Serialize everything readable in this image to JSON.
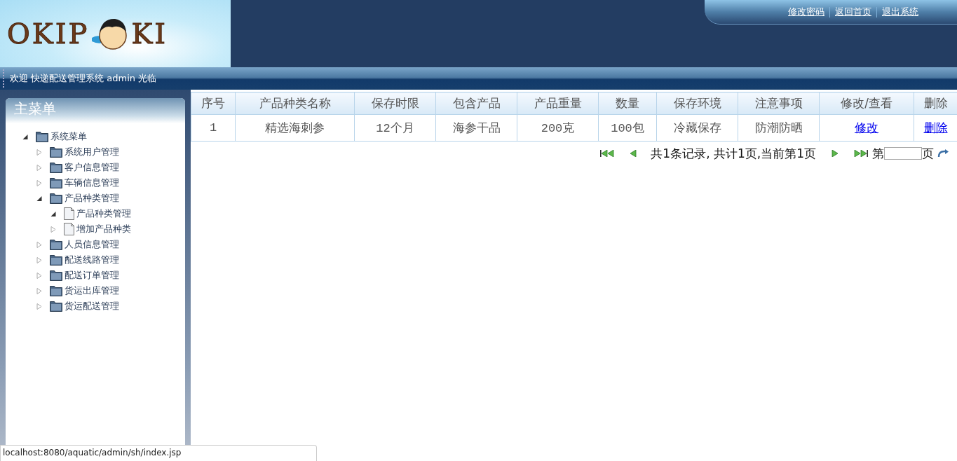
{
  "logo": {
    "left": "OKIP",
    "right": "KI"
  },
  "top_links": [
    "修改密码",
    "返回首页",
    "退出系统"
  ],
  "welcome": "欢迎 快递配送管理系统 admin 光临",
  "sidebar": {
    "title": "主菜单",
    "tree": [
      {
        "label": "系统菜单",
        "kind": "folder",
        "expanded": true,
        "children": [
          {
            "label": "系统用户管理",
            "kind": "folder",
            "expanded": false
          },
          {
            "label": "客户信息管理",
            "kind": "folder",
            "expanded": false
          },
          {
            "label": "车辆信息管理",
            "kind": "folder",
            "expanded": false
          },
          {
            "label": "产品种类管理",
            "kind": "folder",
            "expanded": true,
            "children": [
              {
                "label": "产品种类管理",
                "kind": "file",
                "expanded": true
              },
              {
                "label": "增加产品种类",
                "kind": "file",
                "expanded": false
              }
            ]
          },
          {
            "label": "人员信息管理",
            "kind": "folder",
            "expanded": false
          },
          {
            "label": "配送线路管理",
            "kind": "folder",
            "expanded": false
          },
          {
            "label": "配送订单管理",
            "kind": "folder",
            "expanded": false
          },
          {
            "label": "货运出库管理",
            "kind": "folder",
            "expanded": false
          },
          {
            "label": "货运配送管理",
            "kind": "folder",
            "expanded": false
          }
        ]
      }
    ]
  },
  "table": {
    "columns": [
      "序号",
      "产品种类名称",
      "保存时限",
      "包含产品",
      "产品重量",
      "数量",
      "保存环境",
      "注意事项",
      "修改/查看",
      "删除"
    ],
    "rows": [
      {
        "cells": [
          {
            "text": "1",
            "kind": "text"
          },
          {
            "text": "精选海刺参",
            "kind": "text"
          },
          {
            "text": "12个月",
            "kind": "text"
          },
          {
            "text": "海参干品",
            "kind": "text"
          },
          {
            "text": "200克",
            "kind": "text"
          },
          {
            "text": "100包",
            "kind": "text"
          },
          {
            "text": "冷藏保存",
            "kind": "text"
          },
          {
            "text": "防潮防晒",
            "kind": "text"
          },
          {
            "text": "修改",
            "kind": "link"
          },
          {
            "text": "删除",
            "kind": "link"
          }
        ]
      }
    ]
  },
  "pager": {
    "summary": "共1条记录, 共计1页,当前第1页",
    "page_prefix": "第",
    "page_suffix": "页"
  },
  "status_bar": "localhost:8080/aquatic/admin/sh/index.jsp"
}
